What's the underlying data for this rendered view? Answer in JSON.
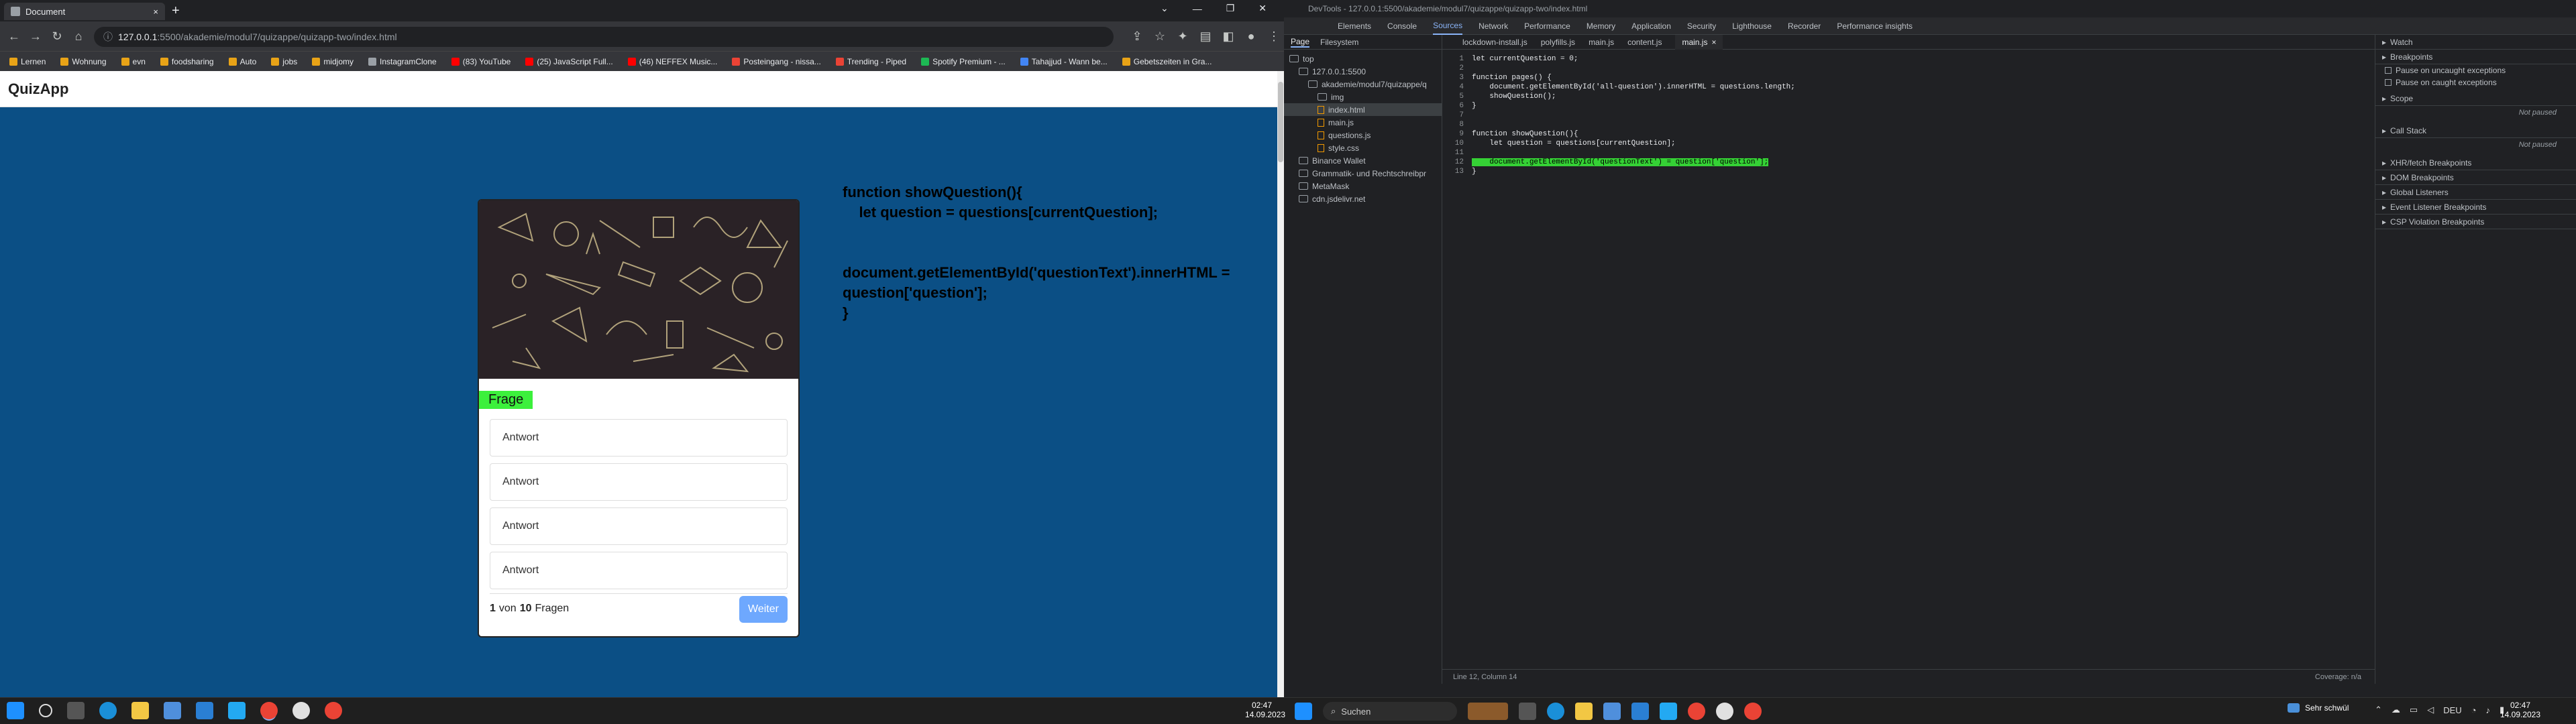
{
  "left_browser": {
    "tab_title": "Document",
    "new_tab_symbol": "+",
    "url_host": "127.0.0.1",
    "url_path": ":5500/akademie/modul7/quizappe/quizapp-two/index.html",
    "bookmarks": [
      "Lernen",
      "Wohnung",
      "evn",
      "foodsharing",
      "Auto",
      "jobs",
      "midjomy",
      "InstagramClone",
      "(83) YouTube",
      "(25) JavaScript Full...",
      "(46) NEFFEX Music...",
      "Posteingang - nissa...",
      "Trending - Piped",
      "Spotify Premium - ...",
      "Tahajjud - Wann be...",
      "Gebetszeiten in Gra..."
    ],
    "bookmark_colors": [
      "#e8a317",
      "#e8a317",
      "#e8a317",
      "#e8a317",
      "#e8a317",
      "#e8a317",
      "#e8a317",
      "#9aa0a6",
      "#ff0000",
      "#ff0000",
      "#ff0000",
      "#ea4335",
      "#ea4335",
      "#1db954",
      "#4285f4",
      "#e8a317"
    ]
  },
  "page": {
    "brand": "QuizApp",
    "question_label": "Frage",
    "answers": [
      "Antwort",
      "Antwort",
      "Antwort",
      "Antwort"
    ],
    "current": "1",
    "of": "von",
    "total": "10",
    "questions_word": "Fragen",
    "next_button": "Weiter",
    "overlay_code": "function showQuestion(){\n    let question = questions[currentQuestion];\n\n\ndocument.getElementById('questionText').innerHTML =\nquestion['question'];\n}"
  },
  "devtools": {
    "window_title": "DevTools - 127.0.0.1:5500/akademie/modul7/quizappe/quizapp-two/index.html",
    "tabs": [
      "Elements",
      "Console",
      "Sources",
      "Network",
      "Performance",
      "Memory",
      "Application",
      "Security",
      "Lighthouse",
      "Recorder",
      "Performance insights"
    ],
    "selected_tab": "Sources",
    "nav_tabs": [
      "Page",
      "Filesystem"
    ],
    "tree": [
      {
        "label": "top",
        "kind": "frame",
        "indent": 0
      },
      {
        "label": "127.0.0.1:5500",
        "kind": "fold",
        "indent": 1
      },
      {
        "label": "akademie/modul7/quizappe/q",
        "kind": "fold",
        "indent": 2
      },
      {
        "label": "img",
        "kind": "fold",
        "indent": 3
      },
      {
        "label": "index.html",
        "kind": "file",
        "indent": 3,
        "selected": true
      },
      {
        "label": "main.js",
        "kind": "file",
        "indent": 3
      },
      {
        "label": "questions.js",
        "kind": "file",
        "indent": 3
      },
      {
        "label": "style.css",
        "kind": "file",
        "indent": 3
      },
      {
        "label": "Binance Wallet",
        "kind": "fold",
        "indent": 1
      },
      {
        "label": "Grammatik- und Rechtschreibpr",
        "kind": "fold",
        "indent": 1
      },
      {
        "label": "MetaMask",
        "kind": "fold",
        "indent": 1
      },
      {
        "label": "cdn.jsdelivr.net",
        "kind": "fold",
        "indent": 1
      }
    ],
    "editor_tabs": [
      "lockdown-install.js",
      "polyfills.js",
      "main.js",
      "content.js",
      "main.js"
    ],
    "editor_close": "×",
    "code_lines": [
      {
        "n": "1",
        "t": "let currentQuestion = 0;"
      },
      {
        "n": "2",
        "t": ""
      },
      {
        "n": "3",
        "t": "function pages() {"
      },
      {
        "n": "4",
        "t": "    document.getElementById('all-question').innerHTML = questions.length;"
      },
      {
        "n": "5",
        "t": "    showQuestion();"
      },
      {
        "n": "6",
        "t": "}"
      },
      {
        "n": "7",
        "t": ""
      },
      {
        "n": "8",
        "t": ""
      },
      {
        "n": "9",
        "t": "function showQuestion(){"
      },
      {
        "n": "10",
        "t": "    let question = questions[currentQuestion];"
      },
      {
        "n": "11",
        "t": ""
      },
      {
        "n": "12",
        "t": "    document.getElementById('questionText') = question['question'];",
        "hl": true
      },
      {
        "n": "13",
        "t": "}"
      }
    ],
    "status_position": "Line 12, Column 14",
    "status_coverage": "Coverage: n/a",
    "debug_sections": [
      "Watch",
      "Breakpoints",
      "Scope",
      "Call Stack",
      "XHR/fetch Breakpoints",
      "DOM Breakpoints",
      "Global Listeners",
      "Event Listener Breakpoints",
      "CSP Violation Breakpoints"
    ],
    "pause_uncaught": "Pause on uncaught exceptions",
    "pause_caught": "Pause on caught exceptions",
    "not_paused": "Not paused"
  },
  "taskbar": {
    "left_time": "02:47",
    "left_date": "14.09.2023",
    "search_label": "Suchen",
    "weather": "Sehr schwül",
    "lang": "DEU",
    "right_time": "02:47",
    "right_date": "14.09.2023"
  }
}
